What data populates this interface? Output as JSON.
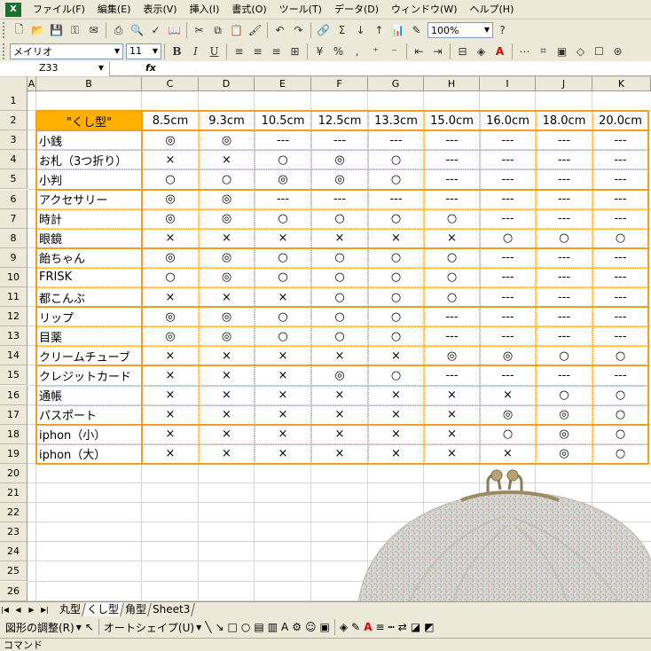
{
  "menu": [
    "ファイル(F)",
    "編集(E)",
    "表示(V)",
    "挿入(I)",
    "書式(O)",
    "ツール(T)",
    "データ(D)",
    "ウィンドウ(W)",
    "ヘルプ(H)"
  ],
  "toolbar": {
    "zoom": "100%"
  },
  "format_bar": {
    "font": "メイリオ",
    "size": "11"
  },
  "name_box": "Z33",
  "fx": "fx",
  "columns": [
    "A",
    "B",
    "C",
    "D",
    "E",
    "F",
    "G",
    "H",
    "I",
    "J",
    "K"
  ],
  "rows": [
    "1",
    "2",
    "3",
    "4",
    "5",
    "6",
    "7",
    "8",
    "9",
    "10",
    "11",
    "12",
    "13",
    "14",
    "15",
    "16",
    "17",
    "18",
    "19",
    "20",
    "21",
    "22",
    "23",
    "24",
    "25",
    "26"
  ],
  "table": {
    "header_label": "\"くし型\"",
    "sizes": [
      "8.5cm",
      "9.3cm",
      "10.5cm",
      "12.5cm",
      "13.3cm",
      "15.0cm",
      "16.0cm",
      "18.0cm",
      "20.0cm"
    ],
    "rows": [
      {
        "label": "小銭",
        "v": [
          "◎",
          "◎",
          "---",
          "---",
          "---",
          "---",
          "---",
          "---",
          "---"
        ]
      },
      {
        "label": "お札（3つ折り）",
        "v": [
          "×",
          "×",
          "○",
          "◎",
          "○",
          "---",
          "---",
          "---",
          "---"
        ]
      },
      {
        "label": "小判",
        "v": [
          "○",
          "○",
          "◎",
          "◎",
          "○",
          "---",
          "---",
          "---",
          "---"
        ]
      },
      {
        "label": "アクセサリー",
        "v": [
          "◎",
          "◎",
          "---",
          "---",
          "---",
          "---",
          "---",
          "---",
          "---"
        ]
      },
      {
        "label": "時計",
        "v": [
          "◎",
          "◎",
          "○",
          "○",
          "○",
          "○",
          "---",
          "---",
          "---"
        ]
      },
      {
        "label": "眼鏡",
        "v": [
          "×",
          "×",
          "×",
          "×",
          "×",
          "×",
          "○",
          "○",
          "○"
        ]
      },
      {
        "label": "飴ちゃん",
        "v": [
          "◎",
          "◎",
          "○",
          "○",
          "○",
          "○",
          "---",
          "---",
          "---"
        ]
      },
      {
        "label": "FRISK",
        "v": [
          "○",
          "◎",
          "○",
          "○",
          "○",
          "○",
          "---",
          "---",
          "---"
        ]
      },
      {
        "label": "都こんぶ",
        "v": [
          "×",
          "×",
          "×",
          "○",
          "○",
          "○",
          "---",
          "---",
          "---"
        ]
      },
      {
        "label": "リップ",
        "v": [
          "◎",
          "◎",
          "○",
          "○",
          "○",
          "---",
          "---",
          "---",
          "---"
        ]
      },
      {
        "label": "目薬",
        "v": [
          "◎",
          "◎",
          "○",
          "○",
          "○",
          "---",
          "---",
          "---",
          "---"
        ]
      },
      {
        "label": "クリームチューブ",
        "v": [
          "×",
          "×",
          "×",
          "×",
          "×",
          "◎",
          "◎",
          "○",
          "○"
        ]
      },
      {
        "label": "クレジットカード",
        "v": [
          "×",
          "×",
          "×",
          "◎",
          "○",
          "---",
          "---",
          "---",
          "---"
        ]
      },
      {
        "label": "通帳",
        "v": [
          "×",
          "×",
          "×",
          "×",
          "×",
          "×",
          "×",
          "○",
          "○"
        ]
      },
      {
        "label": "パスポート",
        "v": [
          "×",
          "×",
          "×",
          "×",
          "×",
          "×",
          "◎",
          "◎",
          "○"
        ]
      },
      {
        "label": "iphon（小）",
        "v": [
          "×",
          "×",
          "×",
          "×",
          "×",
          "×",
          "○",
          "◎",
          "○"
        ]
      },
      {
        "label": "iphon（大）",
        "v": [
          "×",
          "×",
          "×",
          "×",
          "×",
          "×",
          "×",
          "◎",
          "○"
        ]
      }
    ]
  },
  "sheet_tabs": [
    "丸型",
    "くし型",
    "角型",
    "Sheet3"
  ],
  "active_tab": "くし型",
  "drawing": {
    "shape_adjust": "図形の調整(R)",
    "autoshape": "オートシェイプ(U)"
  },
  "status": "コマンド",
  "colors": {
    "accent": "#ffb000",
    "border": "#f0a020"
  }
}
